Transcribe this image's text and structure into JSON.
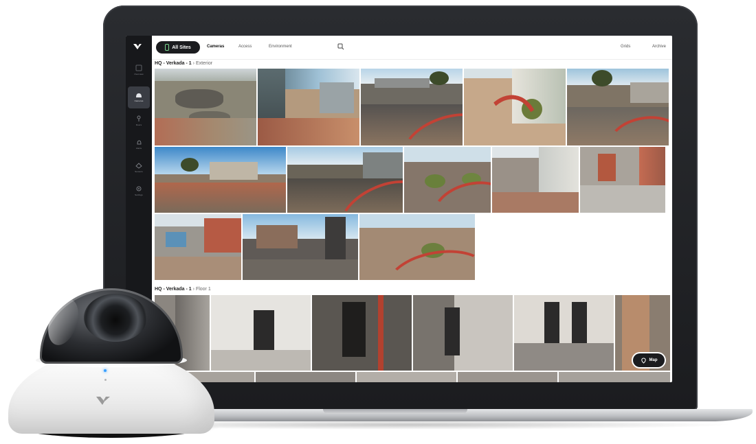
{
  "topbar": {
    "sites_pill": "All Sites",
    "tabs": [
      "Cameras",
      "Access",
      "Environment"
    ],
    "right_actions": [
      "Grids",
      "Archive"
    ]
  },
  "sidebar": {
    "items": [
      {
        "label": "Overview",
        "icon": "home-icon"
      },
      {
        "label": "Cameras",
        "icon": "camera-icon"
      },
      {
        "label": "Doors",
        "icon": "door-icon"
      },
      {
        "label": "Alerts",
        "icon": "bell-icon"
      },
      {
        "label": "Sensors",
        "icon": "sensor-icon"
      },
      {
        "label": "Settings",
        "icon": "gear-icon"
      }
    ]
  },
  "sections": [
    {
      "title": "HQ - Verkada - 1",
      "sub": "Exterior"
    },
    {
      "title": "HQ - Verkada - 1",
      "sub": "Floor 1"
    }
  ],
  "map_button": "Map",
  "colors": {
    "sidebar_bg": "#17181b",
    "pill_bg": "#1b1c1f",
    "pill_accent": "#7bd88f",
    "camera_led": "#3aa0ff",
    "curb_red": "#c24235"
  }
}
